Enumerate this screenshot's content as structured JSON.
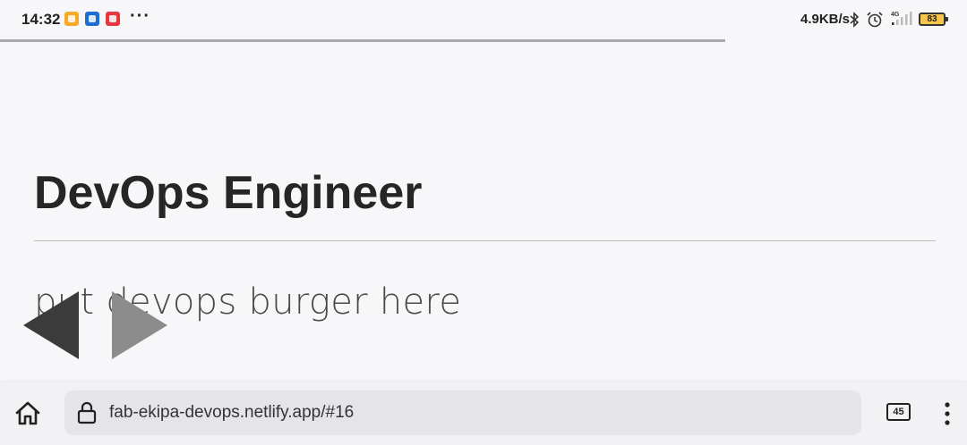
{
  "status_bar": {
    "time": "14:32",
    "more_indicator": "···",
    "network_speed": "4.9KB/s",
    "network_type": "4G",
    "battery_level": "83",
    "icons": [
      "app-notification-icon",
      "app-notification-icon",
      "app-notification-icon",
      "bluetooth-icon",
      "alarm-icon",
      "signal-icon",
      "battery-icon"
    ]
  },
  "page_load_progress": 0.75,
  "slide": {
    "title": "DevOps Engineer",
    "body": "put devops burger here",
    "prev_icon": "triangle-left-icon",
    "next_icon": "triangle-right-icon"
  },
  "browser": {
    "url": "fab-ekipa-devops.netlify.app/#16",
    "tab_count": "45",
    "icons": [
      "home-icon",
      "lock-icon",
      "tabs-icon",
      "more-vertical-icon"
    ]
  },
  "colors": {
    "background": "#f7f7f9",
    "title": "#262626",
    "prev_arrow": "#3b3b3b",
    "next_arrow": "#8c8c8c",
    "battery_fill": "#f6c54a"
  }
}
